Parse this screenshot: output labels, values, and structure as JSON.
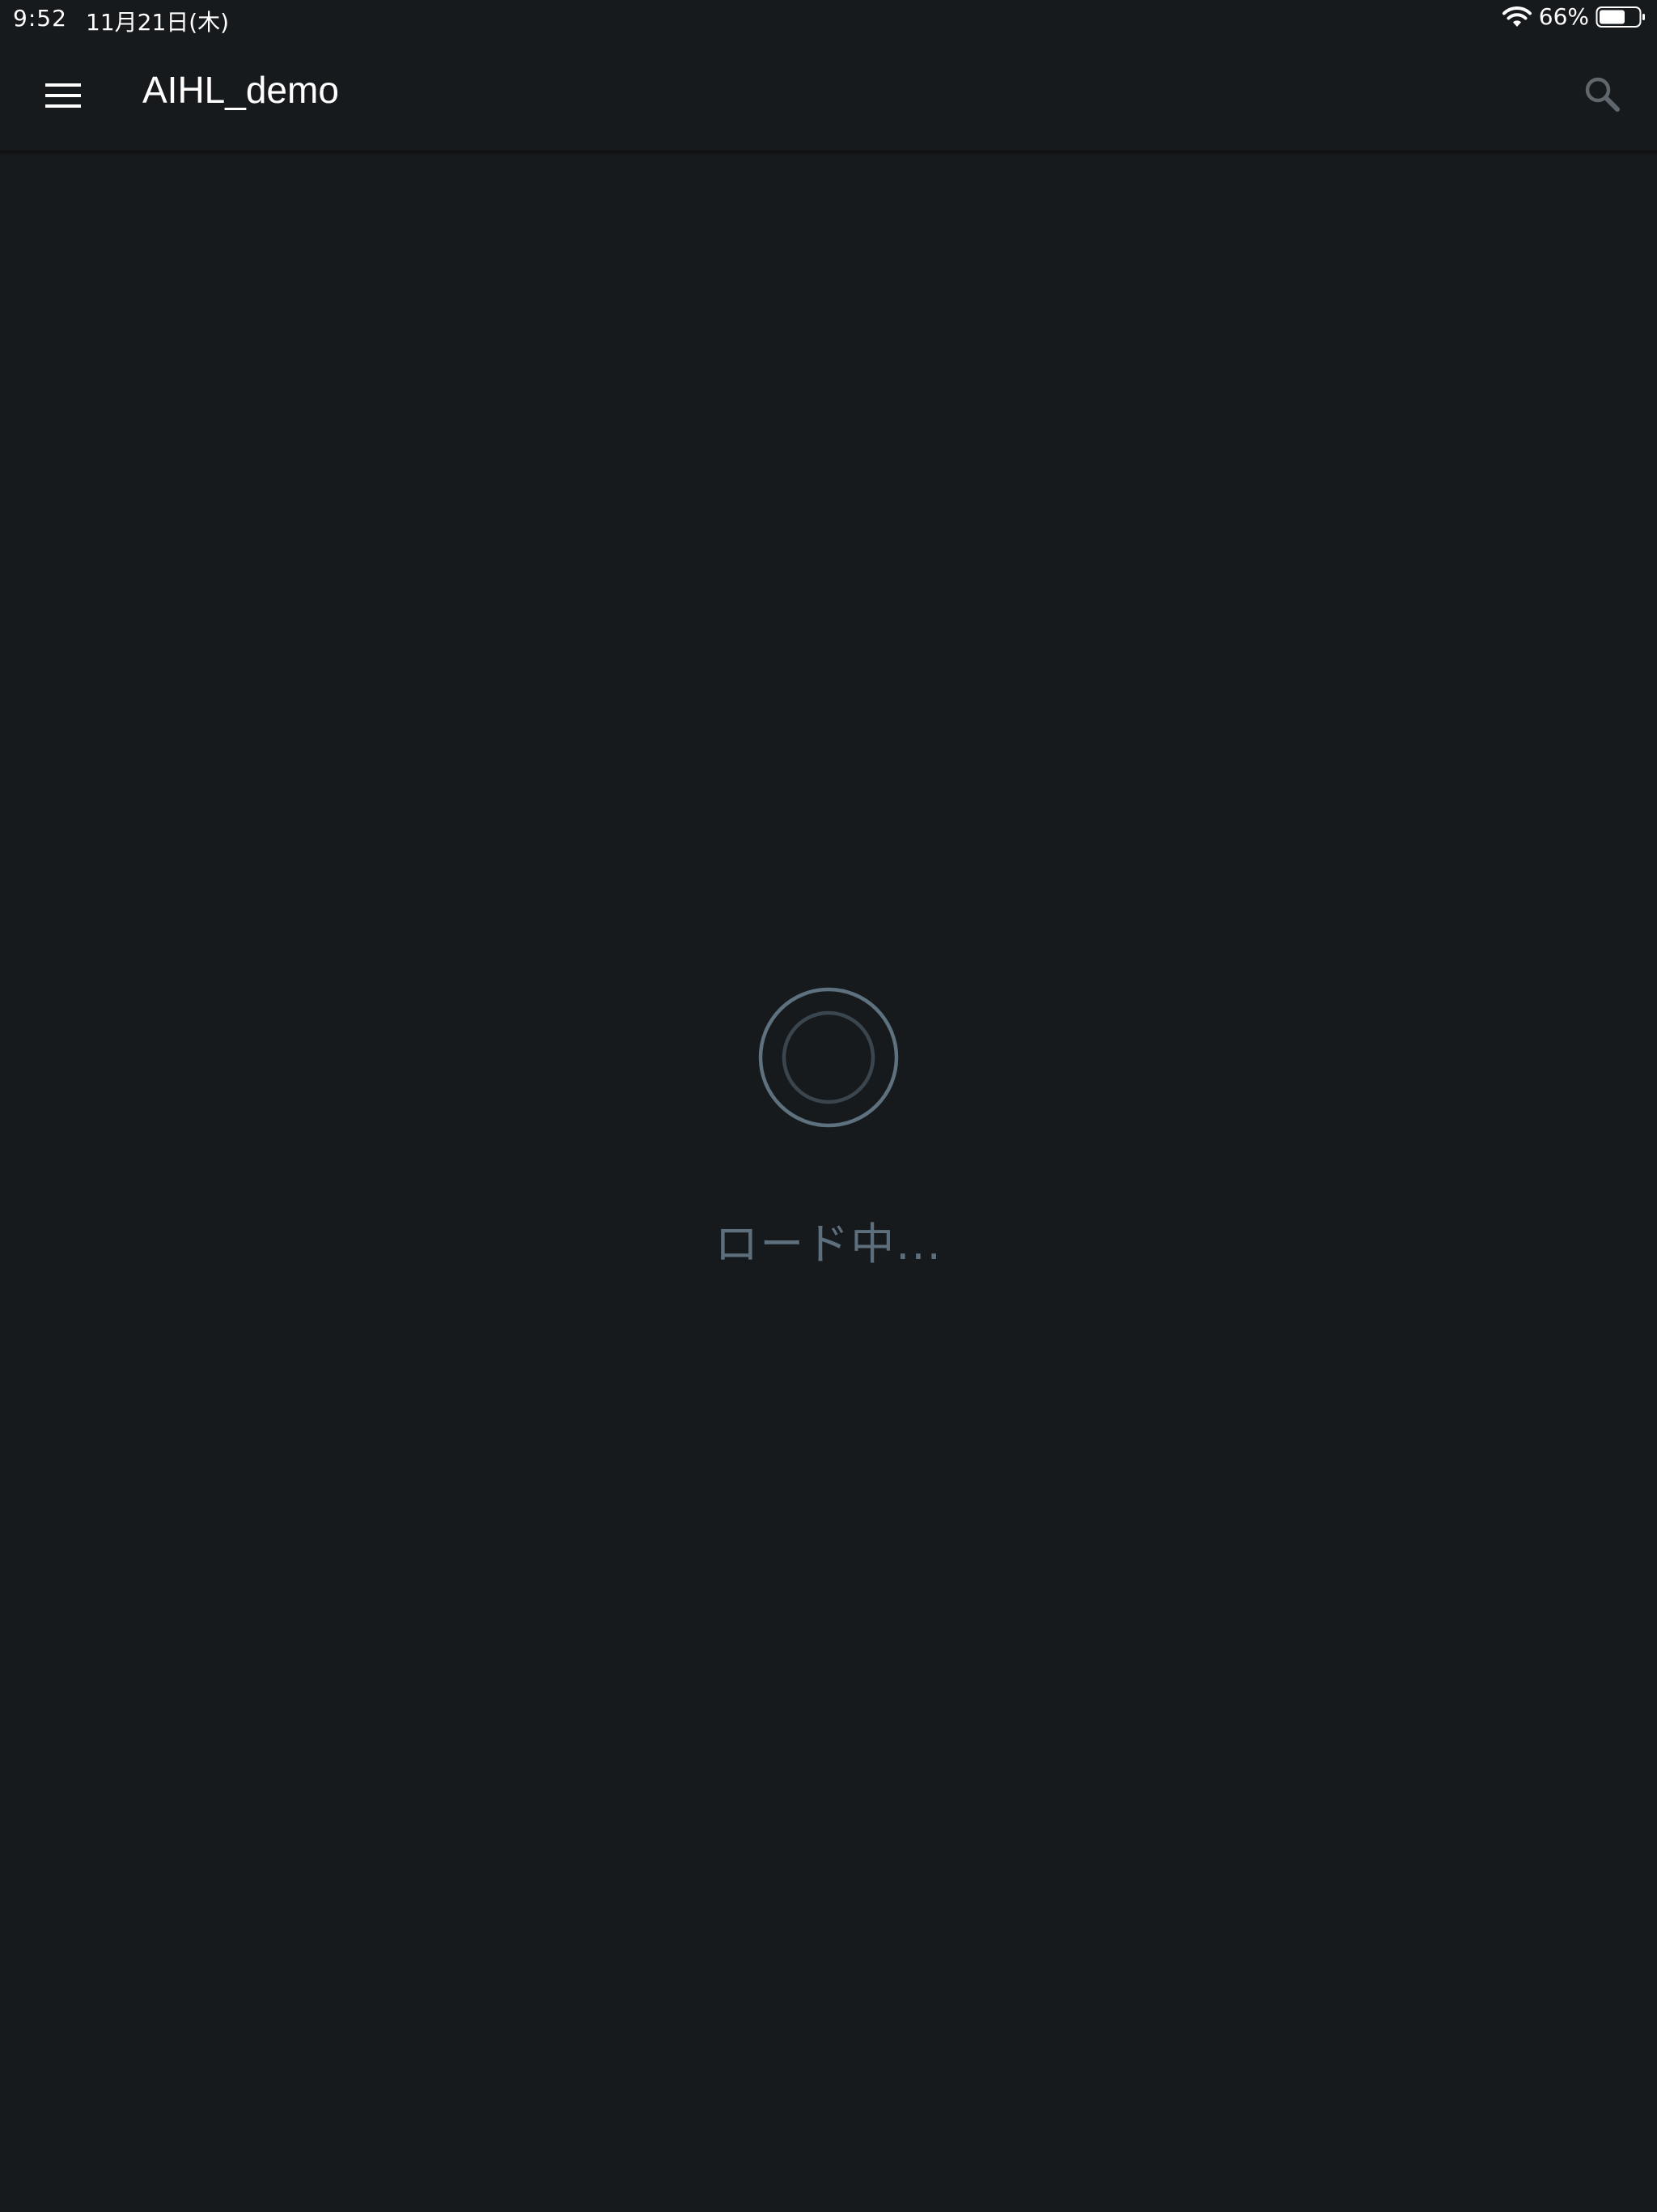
{
  "status_bar": {
    "time": "9:52",
    "date": "11月21日(木)",
    "battery_percent": "66%",
    "battery_level": 0.66
  },
  "app_bar": {
    "title": "AIHL_demo",
    "menu_icon": "hamburger-menu-icon",
    "search_icon": "search-icon"
  },
  "main": {
    "loading_text": "ロード中..."
  },
  "colors": {
    "background": "#171a1d",
    "loader_outer": "#5d717e",
    "loader_inner": "#3a454d",
    "loading_text": "#5d6f7c"
  }
}
